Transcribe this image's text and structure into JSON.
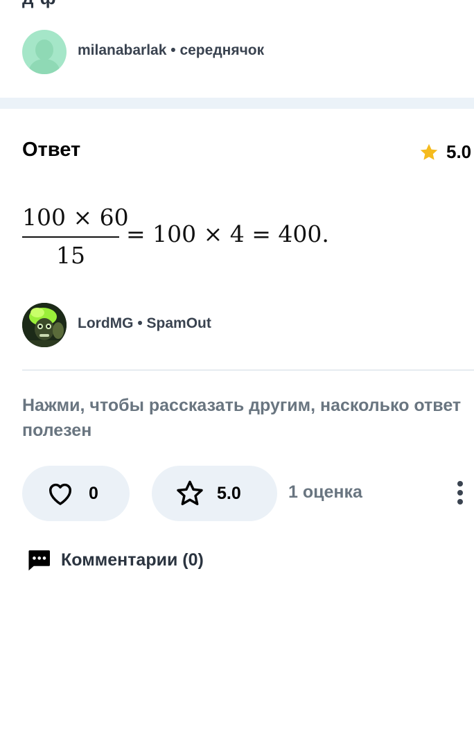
{
  "question_author": {
    "truncated_text": "д ф",
    "username": "milanabarlak",
    "rank": "середнячок",
    "separator": "•"
  },
  "answer": {
    "heading": "Ответ",
    "rating": "5.0",
    "formula": {
      "numerator": "100 × 60",
      "denominator": "15",
      "rest": "= 100 × 4 = 400."
    },
    "author": {
      "username": "LordMG",
      "rank": "SpamOut",
      "separator": "•"
    }
  },
  "feedback": {
    "prompt": "Нажми, чтобы рассказать другим, насколько ответ полезен",
    "likes": "0",
    "rating": "5.0",
    "rating_count": "1 оценка"
  },
  "comments": {
    "label": "Комментарии (0)"
  },
  "colors": {
    "star": "#f5bb1e",
    "pill_bg": "#ebf1f7",
    "muted_text": "#697580",
    "avatar_asker": "#a5e6c8"
  },
  "icons": [
    "user-placeholder-icon",
    "star-filled-icon",
    "heart-icon",
    "star-outline-icon",
    "more-vertical-icon",
    "comment-icon"
  ]
}
